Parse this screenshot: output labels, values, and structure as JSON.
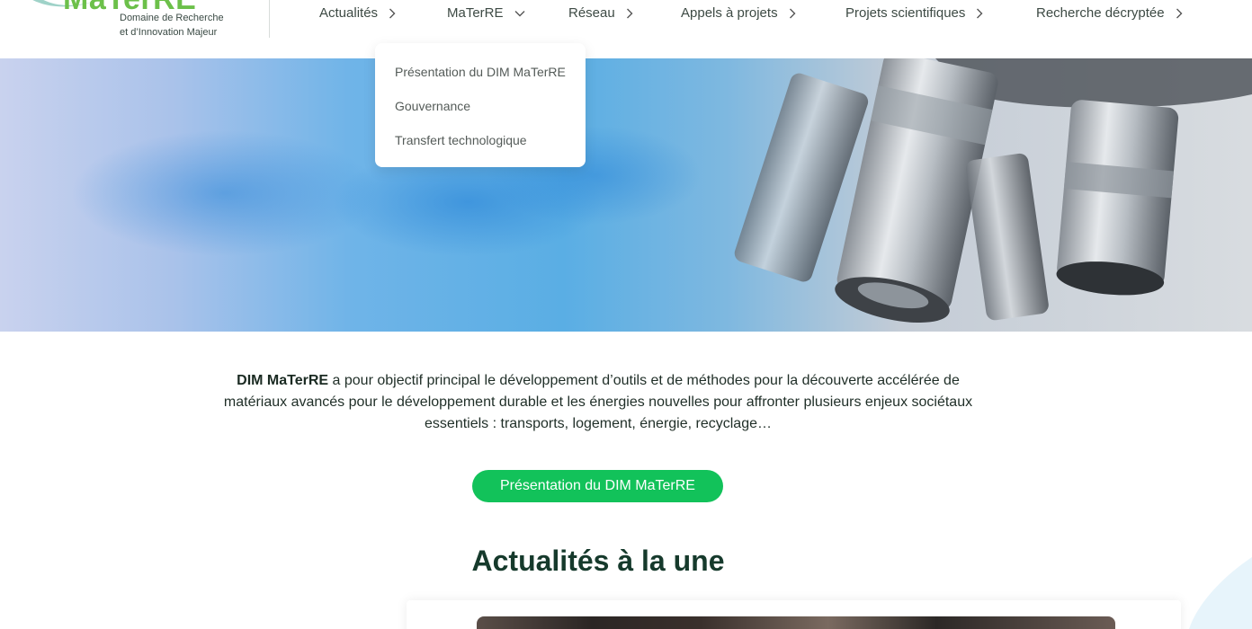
{
  "logo": {
    "wordmark": "MaTerRE",
    "tagline_1": "Domaine de Recherche",
    "tagline_2": "et d’Innovation Majeur"
  },
  "nav": {
    "items": [
      {
        "label": "Actualités",
        "icon": "chevron-right-icon"
      },
      {
        "label": "MaTerRE",
        "icon": "chevron-down-icon"
      },
      {
        "label": "Réseau",
        "icon": "chevron-right-icon"
      },
      {
        "label": "Appels à projets",
        "icon": "chevron-right-icon"
      },
      {
        "label": "Projets scientifiques",
        "icon": "chevron-right-icon"
      },
      {
        "label": "Recherche décryptée",
        "icon": "chevron-right-icon"
      }
    ]
  },
  "dropdown": {
    "items": [
      {
        "label": "Présentation du DIM MaTerRE"
      },
      {
        "label": "Gouvernance"
      },
      {
        "label": "Transfert technologique"
      }
    ]
  },
  "hero": {
    "image": "microscope-objectives-photo"
  },
  "intro": {
    "strong": "DIM MaTerRE",
    "text": " a pour objectif principal le développement d’outils et de méthodes pour la découverte accélérée de matériaux avancés pour le développement durable et les énergies nouvelles pour affronter plusieurs enjeux sociétaux essentiels : transports, logement, énergie, recyclage…"
  },
  "cta": {
    "label": "Présentation du DIM MaTerRE"
  },
  "section": {
    "title": "Actualités à la une"
  },
  "colors": {
    "accent_green": "#12c25a",
    "title_green": "#163a2c",
    "logo_green": "#6cc04a"
  }
}
